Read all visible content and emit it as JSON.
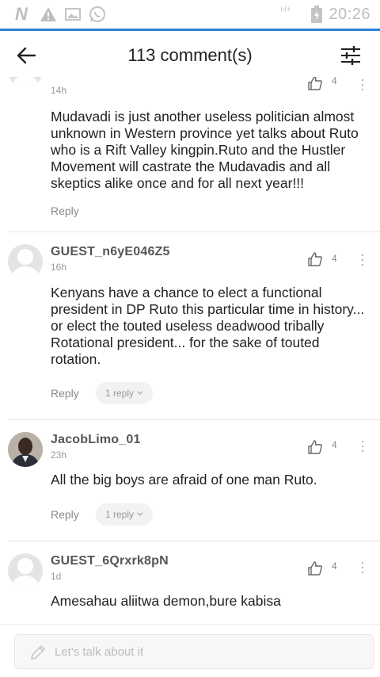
{
  "status_bar": {
    "network": "H+",
    "time": "20:26",
    "icons": [
      "n-logo-icon",
      "warning-icon",
      "image-icon",
      "whatsapp-icon",
      "battery-charging-icon"
    ]
  },
  "header": {
    "title": "113 comment(s)",
    "icons": {
      "back": "arrow-left-icon",
      "filter": "sliders-icon"
    }
  },
  "comments": [
    {
      "username": "",
      "time": "14h",
      "likes": "4",
      "text": "Mudavadi is just another useless politician almost unknown in Western province yet talks about Ruto who is a Rift Valley kingpin.Ruto and the Hustler Movement will castrate the Mudavadis and all skeptics alike once and for all next year!!!",
      "reply_label": "Reply",
      "replies_label": ""
    },
    {
      "username": "GUEST_n6yE046Z5",
      "time": "16h",
      "likes": "4",
      "text": "Kenyans have a chance to elect a functional president in DP Ruto this particular time in history... or elect the touted useless deadwood tribally Rotational president... for the sake of touted rotation.",
      "reply_label": "Reply",
      "replies_label": "1 reply"
    },
    {
      "username": "JacobLimo_01",
      "time": "23h",
      "likes": "4",
      "text": "All the big boys are afraid of one man Ruto.",
      "reply_label": "Reply",
      "replies_label": "1 reply"
    },
    {
      "username": "GUEST_6Qrxrk8pN",
      "time": "1d",
      "likes": "4",
      "text": "Amesahau aliitwa demon,bure kabisa",
      "reply_label": "",
      "replies_label": ""
    }
  ],
  "composer": {
    "placeholder": "Let's talk about it",
    "icon": "pencil-icon"
  },
  "colors": {
    "accent": "#2f7fd6",
    "text": "#222222",
    "muted": "#999999"
  }
}
